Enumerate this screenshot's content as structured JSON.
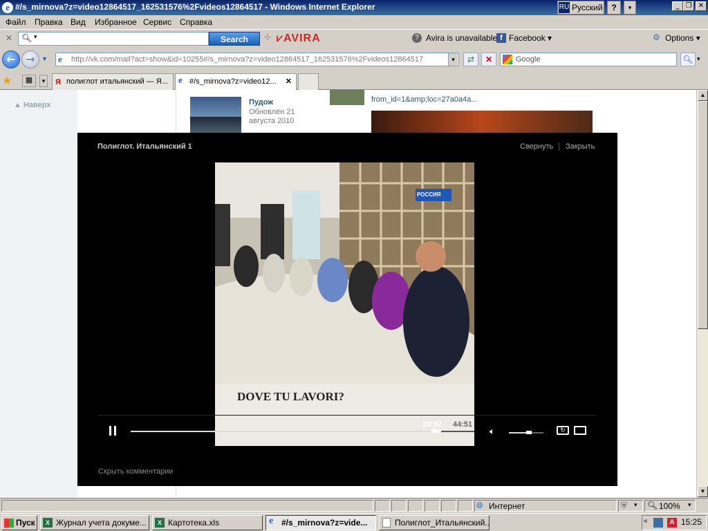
{
  "window": {
    "title": "#/s_mirnova?z=video12864517_162531576%2Fvideos12864517 - Windows Internet Explorer",
    "lang_code": "RU",
    "lang_name": "Русский",
    "help": "?"
  },
  "menu": [
    "Файл",
    "Правка",
    "Вид",
    "Избранное",
    "Сервис",
    "Справка"
  ],
  "avira_toolbar": {
    "search_button": "Search",
    "brand": "AVIRA",
    "status": "Avira is unavailable",
    "facebook": "Facebook",
    "options": "Options"
  },
  "address_bar": {
    "url": "http://vk.com/mail?act=show&id=10255#/s_mirnova?z=video12864517_162531576%2Fvideos12864517",
    "search_placeholder": "Google"
  },
  "tabs": [
    {
      "label": "полиглот итальянский — Я...",
      "active": false
    },
    {
      "label": "#/s_mirnova?z=video12...",
      "active": true
    }
  ],
  "page": {
    "back_link": "Наверх",
    "group_name": "Пудож",
    "group_updated": "Обновлён 21 августа 2010",
    "side_link": "from_id=1&amp;loc=27a0a4a..."
  },
  "video": {
    "title": "Полиглот. Итальянский 1",
    "minimize": "Свернуть",
    "close": "Закрыть",
    "caption": "DOVE TU LAVORI?",
    "channel_logo": "РОССИЯ",
    "time_current": "39:52",
    "time_total": "44:51",
    "progress": 0.89,
    "volume": 0.58,
    "hide_comments": "Скрыть комментарии"
  },
  "status_bar": {
    "zone": "Интернет",
    "zoom": "100%"
  },
  "taskbar": {
    "start": "Пуск",
    "tasks": [
      {
        "label": "Журнал учета докуме...",
        "active": false
      },
      {
        "label": "Картотека.xls",
        "active": false
      },
      {
        "label": "#/s_mirnova?z=vide...",
        "active": true
      },
      {
        "label": "Полиглот_Итальянский...",
        "active": false
      }
    ],
    "clock": "15:25"
  },
  "colors": {
    "titlebar": "#0a246a",
    "overlay": "#000000",
    "avira_red": "#d2232a",
    "vk_link": "#2b587a"
  }
}
